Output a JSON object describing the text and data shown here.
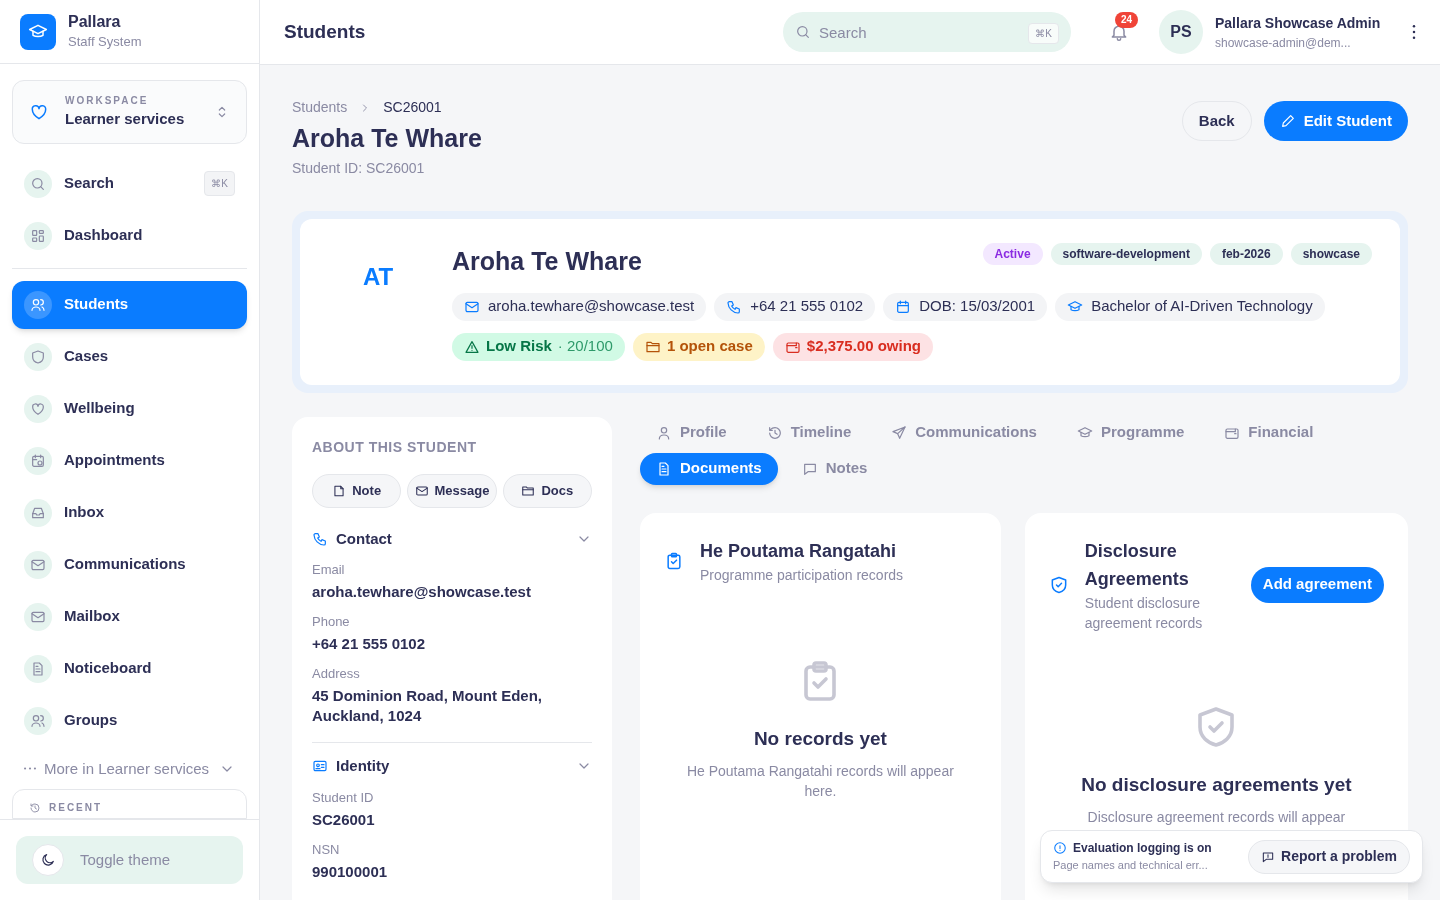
{
  "brand": {
    "name": "Pallara",
    "subtitle": "Staff System"
  },
  "workspace": {
    "label": "WORKSPACE",
    "value": "Learner services"
  },
  "sidebar": {
    "top_items": [
      {
        "label": "Search",
        "shortcut": "⌘K",
        "selected": false
      },
      {
        "label": "Dashboard",
        "selected": false
      }
    ],
    "items": [
      {
        "label": "Students",
        "selected": true
      },
      {
        "label": "Cases",
        "selected": false
      },
      {
        "label": "Wellbeing",
        "selected": false
      },
      {
        "label": "Appointments",
        "selected": false
      },
      {
        "label": "Inbox",
        "selected": false
      },
      {
        "label": "Communications",
        "selected": false
      },
      {
        "label": "Mailbox",
        "selected": false
      },
      {
        "label": "Noticeboard",
        "selected": false
      },
      {
        "label": "Groups",
        "selected": false
      }
    ],
    "more": "More in Learner services",
    "recent": "RECENT",
    "toggle_theme": "Toggle theme"
  },
  "header": {
    "title": "Students",
    "search": {
      "placeholder": "Search",
      "shortcut": "⌘K"
    },
    "notifications": "24",
    "user": {
      "initials": "PS",
      "name": "Pallara Showcase Admin",
      "email": "showcase-admin@dem..."
    }
  },
  "breadcrumb": [
    {
      "label": "Students"
    },
    {
      "label": "SC26001"
    }
  ],
  "page": {
    "title": "Aroha Te Whare",
    "subtitle": "Student ID: SC26001",
    "buttons": [
      {
        "label": "Back",
        "kind": "secondary"
      },
      {
        "label": "Edit Student",
        "kind": "primary"
      }
    ]
  },
  "profile": {
    "initials": "AT",
    "name": "Aroha Te Whare",
    "tags": [
      {
        "label": "Active",
        "color": "#f3e8ff"
      },
      {
        "label": "software-development",
        "color": "#e6f4ef"
      },
      {
        "label": "feb-2026",
        "color": "#e6f4ef"
      },
      {
        "label": "showcase",
        "color": "#e6f4ef"
      }
    ],
    "details": [
      "aroha.tewhare@showcase.test",
      "+64 21 555 0102",
      "DOB: 15/03/2001",
      "Bachelor of AI-Driven Technology"
    ],
    "badges": [
      {
        "kind": "risk",
        "label": "Low Risk",
        "extra": "· 20/100"
      },
      {
        "kind": "case",
        "label": "1 open case"
      },
      {
        "kind": "owing",
        "label": "$2,375.00 owing"
      }
    ]
  },
  "about": {
    "title": "ABOUT THIS STUDENT",
    "actions": [
      "Note",
      "Message",
      "Docs"
    ],
    "sections": [
      {
        "title": "Contact",
        "expanded": true,
        "fields": [
          {
            "label": "Email",
            "value": "aroha.tewhare@showcase.test"
          },
          {
            "label": "Phone",
            "value": "+64 21 555 0102"
          },
          {
            "label": "Address",
            "value": "45 Dominion Road, Mount Eden, Auckland, 1024"
          }
        ]
      },
      {
        "title": "Identity",
        "expanded": true,
        "fields": [
          {
            "label": "Student ID",
            "value": "SC26001"
          },
          {
            "label": "NSN",
            "value": "990100001"
          }
        ]
      }
    ]
  },
  "tabs": [
    {
      "label": "Profile",
      "selected": false
    },
    {
      "label": "Timeline",
      "selected": false
    },
    {
      "label": "Communications",
      "selected": false
    },
    {
      "label": "Programme",
      "selected": false
    },
    {
      "label": "Financial",
      "selected": false
    },
    {
      "label": "Documents",
      "selected": true
    },
    {
      "label": "Notes",
      "selected": false
    }
  ],
  "cards": [
    {
      "title": "He Poutama Rangatahi",
      "subtitle": "Programme participation records",
      "empty_title": "No records yet",
      "empty_text": "He Poutama Rangatahi records will appear here."
    },
    {
      "title": "Disclosure Agreements",
      "subtitle": "Student disclosure agreement records",
      "action": "Add agreement",
      "empty_title": "No disclosure agreements yet",
      "empty_text": "Disclosure agreement records will appear"
    }
  ],
  "toast": {
    "title": "Evaluation logging is on",
    "text": "Page names and technical err...",
    "button": "Report a problem"
  }
}
